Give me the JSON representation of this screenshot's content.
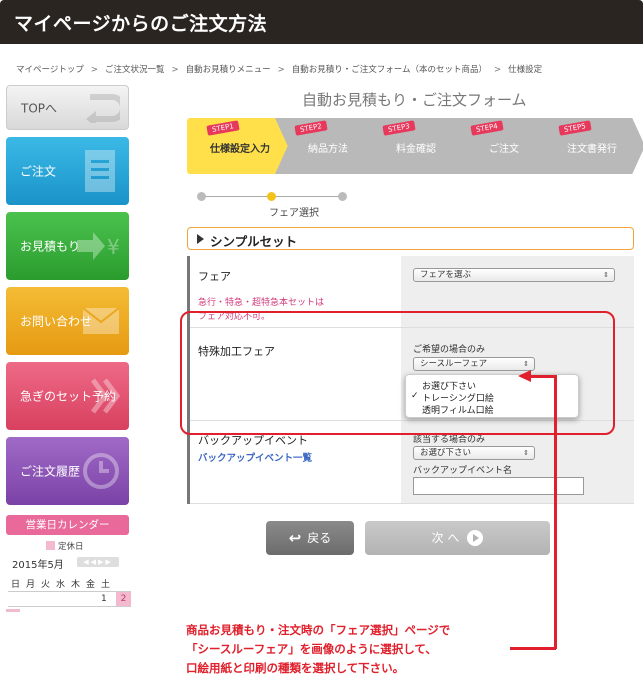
{
  "page_title": "マイページからのご注文方法",
  "breadcrumb": [
    "マイページトップ",
    "ご注文状況一覧",
    "自動お見積りメニュー",
    "自動お見積り・ご注文フォーム（本のセット商品）",
    "仕様設定"
  ],
  "breadcrumb_separator": ">",
  "sidebar": {
    "top": "TOPへ",
    "order": "ご注文",
    "estimate": "お見積もり",
    "contact": "お問い合わせ",
    "urgent": "急ぎのセット予約",
    "history": "ご注文履歴"
  },
  "calendar": {
    "title": "営業日カレンダー",
    "legend": "定休日",
    "month": "2015年5月",
    "weekdays": [
      "日",
      "月",
      "火",
      "水",
      "木",
      "金",
      "土"
    ],
    "day1": "1",
    "day2": "2"
  },
  "form_title": "自動お見積もり・ご注文フォーム",
  "steps": [
    {
      "badge": "STEP1",
      "name": "仕様設定入力",
      "active": true
    },
    {
      "badge": "STEP2",
      "name": "納品方法",
      "active": false
    },
    {
      "badge": "STEP3",
      "name": "料金確認",
      "active": false
    },
    {
      "badge": "STEP4",
      "name": "ご注文",
      "active": false
    },
    {
      "badge": "STEP5",
      "name": "注文書発行",
      "active": false
    }
  ],
  "progress": {
    "current_index": 1,
    "total": 3,
    "label": "フェア選択"
  },
  "set_header": "シンプルセット",
  "rows": {
    "fair": {
      "label": "フェア",
      "note_line1": "急行・特急・超特急本セットは",
      "note_line2": "フェア対応不可。",
      "select_value": "フェアを選ぶ"
    },
    "special": {
      "label": "特殊加工フェア",
      "hint": "ご希望の場合のみ",
      "select_value": "シースルーフェア",
      "options": [
        "お選び下さい",
        "トレーシング口絵",
        "透明フィルム口絵"
      ],
      "checked_option": "トレーシング口絵"
    },
    "backup": {
      "label": "バックアップイベント",
      "link": "バックアップイベント一覧",
      "hint": "該当する場合のみ",
      "select_value": "お選び下さい",
      "name_label": "バックアップイベント名",
      "name_value": ""
    }
  },
  "buttons": {
    "back": "戻る",
    "next": "次 へ"
  },
  "checkmark": "✓",
  "caret": "⇕",
  "callout": {
    "line1": "商品お見積もり・注文時の「フェア選択」ページで",
    "line2": "「シースルーフェア」を画像のように選択して、",
    "line3": "口絵用紙と印刷の種類を選択して下さい。"
  },
  "colors": {
    "accent_red": "#e0202c",
    "step_active": "#ffe04a",
    "note_pink": "#d13a7a",
    "link_blue": "#3a66c4"
  }
}
